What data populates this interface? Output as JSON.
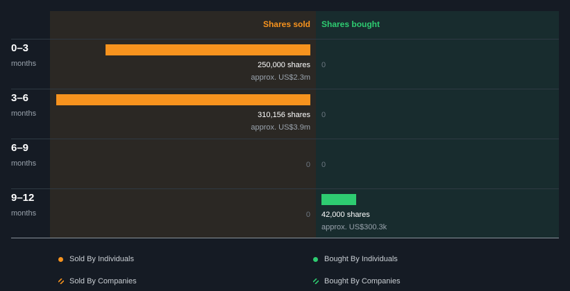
{
  "chart_data": {
    "type": "bar",
    "headers": {
      "sold": "Shares sold",
      "bought": "Shares bought"
    },
    "rows": [
      {
        "label": "0–3",
        "unit": "months",
        "sold": {
          "shares": 250000,
          "text": "250,000 shares",
          "approx": "approx. US$2.3m"
        },
        "bought": {
          "shares": 0,
          "text": "0",
          "approx": ""
        }
      },
      {
        "label": "3–6",
        "unit": "months",
        "sold": {
          "shares": 310156,
          "text": "310,156 shares",
          "approx": "approx. US$3.9m"
        },
        "bought": {
          "shares": 0,
          "text": "0",
          "approx": ""
        }
      },
      {
        "label": "6–9",
        "unit": "months",
        "sold": {
          "shares": 0,
          "text": "0",
          "approx": ""
        },
        "bought": {
          "shares": 0,
          "text": "0",
          "approx": ""
        }
      },
      {
        "label": "9–12",
        "unit": "months",
        "sold": {
          "shares": 0,
          "text": "0",
          "approx": ""
        },
        "bought": {
          "shares": 42000,
          "text": "42,000 shares",
          "approx": "approx. US$300.3k"
        }
      }
    ],
    "legend": [
      {
        "label": "Sold By Individuals",
        "style": "dot",
        "color": "#f7931e"
      },
      {
        "label": "Bought By Individuals",
        "style": "dot",
        "color": "#2ecc71"
      },
      {
        "label": "Sold By Companies",
        "style": "hatch",
        "color": "#f7931e"
      },
      {
        "label": "Bought By Companies",
        "style": "hatch",
        "color": "#2ecc71"
      }
    ],
    "colors": {
      "sold": "#f7931e",
      "bought": "#2ecc71"
    }
  }
}
